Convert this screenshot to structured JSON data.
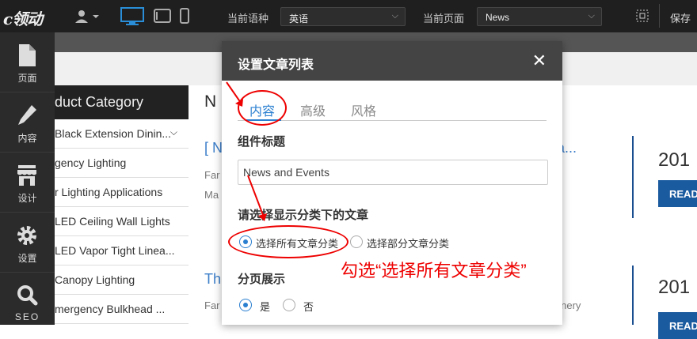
{
  "topbar": {
    "logo_text": "c领动",
    "language_label": "当前语种",
    "language_value": "英语",
    "page_label": "当前页面",
    "page_value": "News",
    "save_label": "保存"
  },
  "leftnav": {
    "items": [
      {
        "label": "页面",
        "icon": "file-icon"
      },
      {
        "label": "内容",
        "icon": "pencil-icon"
      },
      {
        "label": "设计",
        "icon": "store-icon"
      },
      {
        "label": "设置",
        "icon": "gear-icon"
      },
      {
        "label": "SEO",
        "icon": "search-icon"
      }
    ]
  },
  "background": {
    "category_title": "duct Category",
    "categories": [
      "Black Extension Dinin...",
      "gency Lighting",
      "r Lighting Applications",
      "LED Ceiling Wall Lights",
      "LED Vapor Tight Linea...",
      "Canopy Lighting",
      "mergency Bulkhead ..."
    ],
    "heading_partial": "N",
    "link1_left": "[ N",
    "link1_right": "t fa...",
    "text_fa1": "Far",
    "text_ma": "Ma",
    "text_th": "Th",
    "text_fa2": "Far",
    "text_inery": "hinery",
    "year1": "201",
    "year2": "201",
    "read_label": "READ"
  },
  "modal": {
    "title": "设置文章列表",
    "tabs": [
      "内容",
      "高级",
      "风格"
    ],
    "component_title_label": "组件标题",
    "component_title_value": "News and Events",
    "category_question": "请选择显示分类下的文章",
    "radio_all": "选择所有文章分类",
    "radio_partial": "选择部分文章分类",
    "paging_label": "分页展示",
    "paging_yes": "是",
    "paging_no": "否"
  },
  "annotation": {
    "text": "勾选“选择所有文章分类”",
    "color": "#e00000"
  }
}
